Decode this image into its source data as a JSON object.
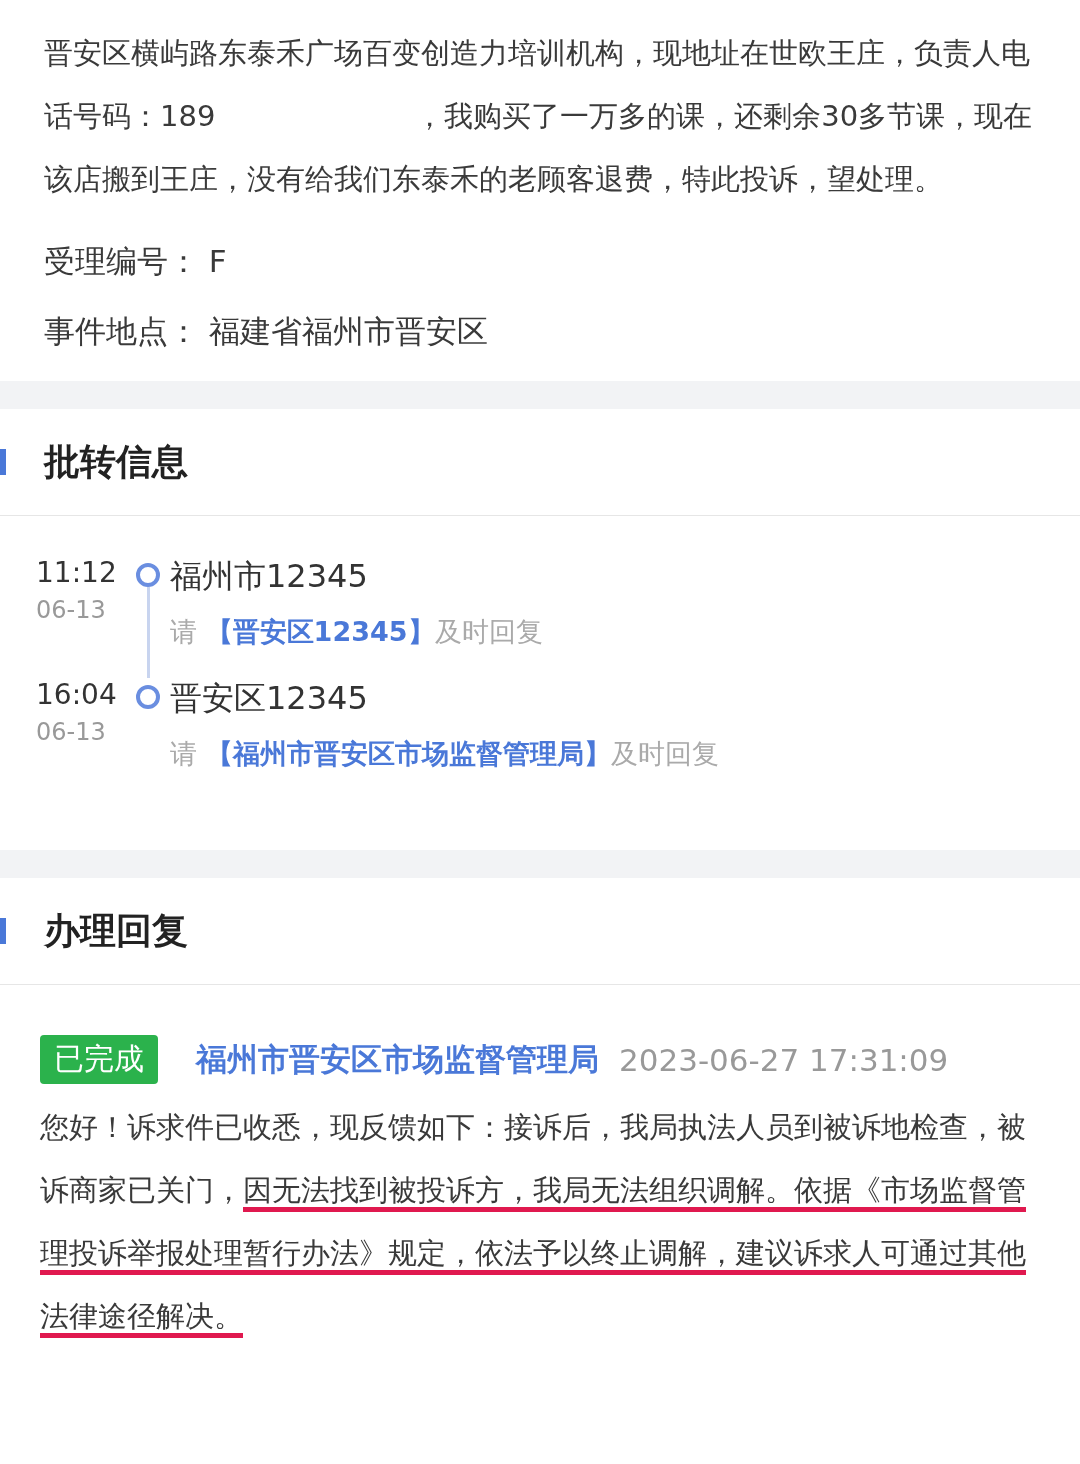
{
  "complaint": {
    "description": [
      "晋安区横屿路东泰禾广场百变创造力培训机构，现地址在世欧王庄，负责人电话号码：189",
      "，我购买了一万多的课，还剩余30多节课，现在该店搬到王庄，没有给我们东泰禾的老顾客退费，特此投诉，望处理。"
    ],
    "fields": [
      {
        "label": "受理编号：",
        "value": "F"
      },
      {
        "label": "事件地点：",
        "value": "福建省福州市晋安区"
      }
    ]
  },
  "transfer": {
    "title": "批转信息",
    "steps": [
      {
        "time": "11:12",
        "date": "06-13",
        "unit": "福州市12345",
        "prefix": "请",
        "target": "【晋安区12345】",
        "suffix": "及时回复"
      },
      {
        "time": "16:04",
        "date": "06-13",
        "unit": "晋安区12345",
        "prefix": "请",
        "target": "【福州市晋安区市场监督管理局】",
        "suffix": "及时回复"
      }
    ]
  },
  "reply": {
    "title": "办理回复",
    "status": "已完成",
    "unit": "福州市晋安区市场监督管理局",
    "datetime": "2023-06-27 17:31:09",
    "segments": [
      {
        "text": "您好！诉求件已收悉，现反馈如下：接诉后，我局执法人员到被诉地检查，被诉商家已关门，",
        "underlined": false
      },
      {
        "text": "因无法找到被投诉方，我局无法组织调解。依据《市场监督管理投诉举报处理暂行办法》规定，依法予以终止调解，建议诉求人可通过其他法律途径解决。",
        "underlined": true
      }
    ]
  }
}
